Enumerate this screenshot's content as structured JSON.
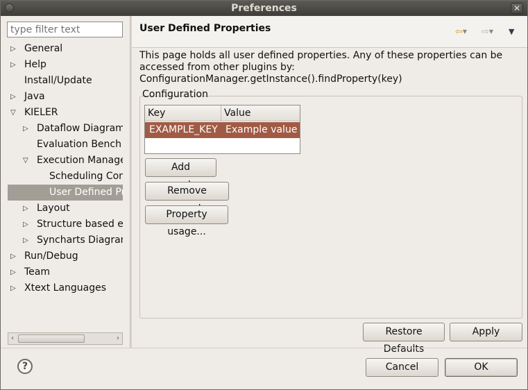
{
  "window": {
    "title": "Preferences",
    "close_glyph": "✕"
  },
  "filter": {
    "placeholder": "type filter text"
  },
  "tree": {
    "items": [
      {
        "label": "General",
        "expandable": true,
        "expanded": false
      },
      {
        "label": "Help",
        "expandable": true,
        "expanded": false
      },
      {
        "label": "Install/Update",
        "expandable": false
      },
      {
        "label": "Java",
        "expandable": true,
        "expanded": false
      },
      {
        "label": "KIELER",
        "expandable": true,
        "expanded": true
      },
      {
        "label": "Dataflow Diagram",
        "expandable": true,
        "expanded": false
      },
      {
        "label": "Evaluation Bench",
        "expandable": false
      },
      {
        "label": "Execution Manager",
        "expandable": true,
        "expanded": true
      },
      {
        "label": "Scheduling Conf",
        "expandable": false
      },
      {
        "label": "User Defined Pro",
        "expandable": false,
        "selected": true
      },
      {
        "label": "Layout",
        "expandable": true,
        "expanded": false
      },
      {
        "label": "Structure based edi",
        "expandable": true,
        "expanded": false
      },
      {
        "label": "Syncharts Diagran",
        "expandable": true,
        "expanded": false
      },
      {
        "label": "Run/Debug",
        "expandable": true,
        "expanded": false
      },
      {
        "label": "Team",
        "expandable": true,
        "expanded": false
      },
      {
        "label": "Xtext Languages",
        "expandable": true,
        "expanded": false
      }
    ]
  },
  "page": {
    "title": "User Defined Properties",
    "description": "This page holds all user defined properties. Any of these properties can be accessed from other plugins by: ConfigurationManager.getInstance().findProperty(key)",
    "group_label": "Configuration",
    "table": {
      "columns": [
        "Key",
        "Value"
      ],
      "rows": [
        {
          "key": "EXAMPLE_KEY",
          "value": "Example value"
        }
      ]
    },
    "buttons": {
      "add": "Add property...",
      "remove": "Remove property",
      "usage": "Property usage...",
      "restore_defaults": "Restore Defaults",
      "apply": "Apply"
    }
  },
  "footer": {
    "help_glyph": "?",
    "cancel": "Cancel",
    "ok": "OK"
  },
  "colors": {
    "selection_tree": "#a39e95",
    "selection_table": "#a15b45",
    "titlebar": "#3e3d39"
  }
}
